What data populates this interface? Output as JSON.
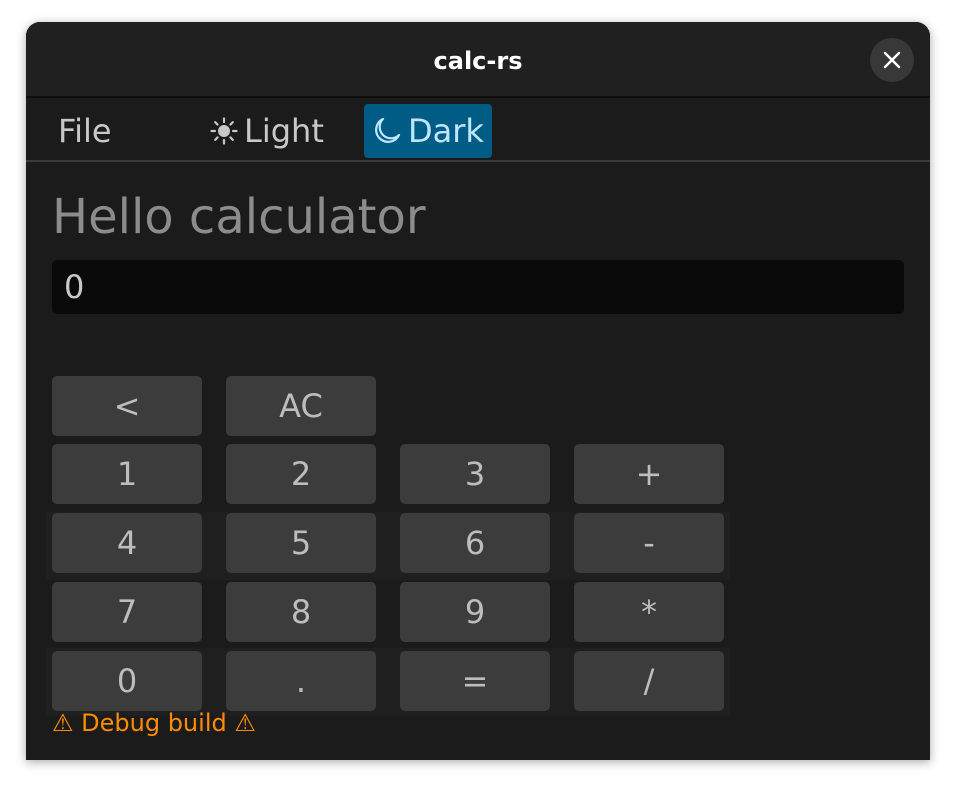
{
  "window": {
    "title": "calc-rs"
  },
  "menu": {
    "file": "File",
    "light": "Light",
    "dark": "Dark",
    "selected_theme": "Dark"
  },
  "heading": "Hello calculator",
  "display_value": "0",
  "keys": {
    "backspace": "<",
    "clear": "AC",
    "one": "1",
    "two": "2",
    "three": "3",
    "plus": "+",
    "four": "4",
    "five": "5",
    "six": "6",
    "minus": "-",
    "seven": "7",
    "eight": "8",
    "nine": "9",
    "multiply": "*",
    "zero": "0",
    "dot": ".",
    "equals": "=",
    "divide": "/"
  },
  "footer": {
    "debug": "⚠ Debug build ⚠"
  },
  "colors": {
    "accent": "#005c84",
    "warning": "#ff8c00"
  }
}
